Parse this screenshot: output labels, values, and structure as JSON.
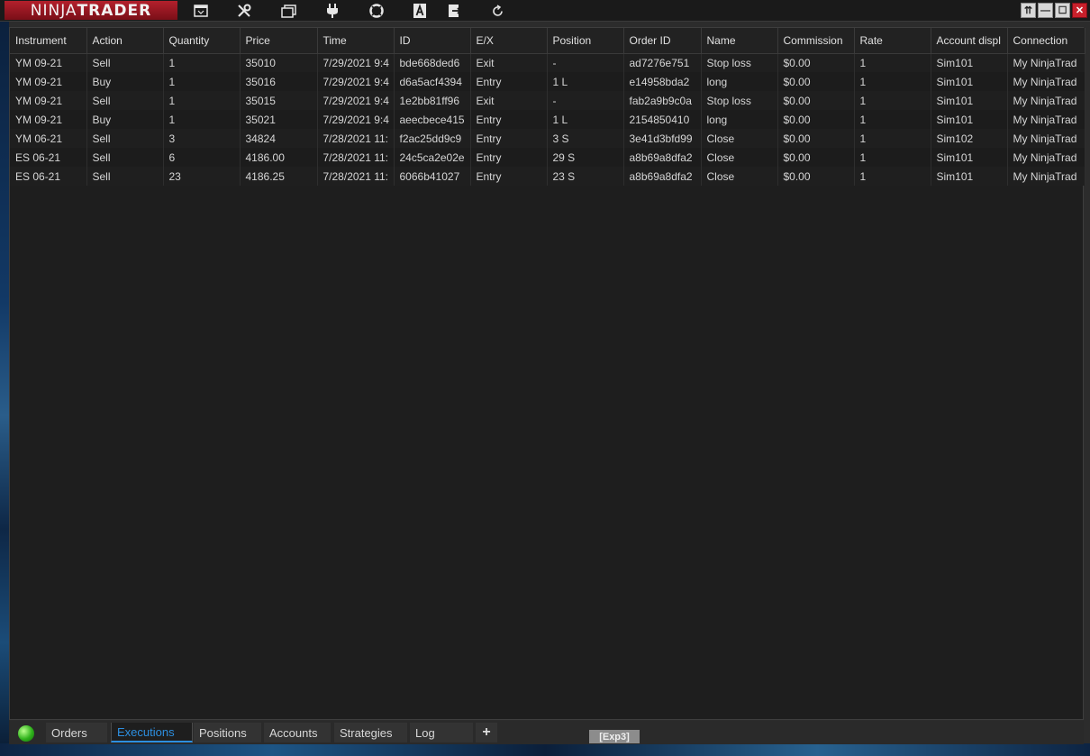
{
  "app": {
    "logo_left": "NINJA",
    "logo_right": "TRADER"
  },
  "toolbar": {
    "icons": [
      "new-window-icon",
      "tools-icon",
      "workspaces-icon",
      "connections-icon",
      "help-icon",
      "font-icon",
      "export-icon",
      "refresh-icon"
    ]
  },
  "window_controls": {
    "pin": "⇈",
    "minimize": "—",
    "maximize": "☐",
    "close": "✕"
  },
  "grid": {
    "columns": [
      "Instrument",
      "Action",
      "Quantity",
      "Price",
      "Time",
      "ID",
      "E/X",
      "Position",
      "Order ID",
      "Name",
      "Commission",
      "Rate",
      "Account displ",
      "Connection"
    ],
    "rows": [
      [
        "YM 09-21",
        "Sell",
        "1",
        "35010",
        "7/29/2021 9:4",
        "bde668ded6",
        "Exit",
        "-",
        "ad7276e751",
        "Stop loss",
        "$0.00",
        "1",
        "Sim101",
        "My NinjaTrad"
      ],
      [
        "YM 09-21",
        "Buy",
        "1",
        "35016",
        "7/29/2021 9:4",
        "d6a5acf4394",
        "Entry",
        "1 L",
        "e14958bda2",
        "long",
        "$0.00",
        "1",
        "Sim101",
        "My NinjaTrad"
      ],
      [
        "YM 09-21",
        "Sell",
        "1",
        "35015",
        "7/29/2021 9:4",
        "1e2bb81ff96",
        "Exit",
        "-",
        "fab2a9b9c0a",
        "Stop loss",
        "$0.00",
        "1",
        "Sim101",
        "My NinjaTrad"
      ],
      [
        "YM 09-21",
        "Buy",
        "1",
        "35021",
        "7/29/2021 9:4",
        "aeecbece415",
        "Entry",
        "1 L",
        "2154850410",
        "long",
        "$0.00",
        "1",
        "Sim101",
        "My NinjaTrad"
      ],
      [
        "YM 06-21",
        "Sell",
        "3",
        "34824",
        "7/28/2021 11:",
        "f2ac25dd9c9",
        "Entry",
        "3 S",
        "3e41d3bfd99",
        "Close",
        "$0.00",
        "1",
        "Sim102",
        "My NinjaTrad"
      ],
      [
        "ES 06-21",
        "Sell",
        "6",
        "4186.00",
        "7/28/2021 11:",
        "24c5ca2e02e",
        "Entry",
        "29 S",
        "a8b69a8dfa2",
        "Close",
        "$0.00",
        "1",
        "Sim101",
        "My NinjaTrad"
      ],
      [
        "ES 06-21",
        "Sell",
        "23",
        "4186.25",
        "7/28/2021 11:",
        "6066b41027",
        "Entry",
        "23 S",
        "a8b69a8dfa2",
        "Close",
        "$0.00",
        "1",
        "Sim101",
        "My NinjaTrad"
      ]
    ]
  },
  "tabs": [
    {
      "label": "Orders",
      "active": false
    },
    {
      "label": "Executions",
      "active": true
    },
    {
      "label": "Positions",
      "active": false
    },
    {
      "label": "Accounts",
      "active": false
    },
    {
      "label": "Strategies",
      "active": false
    },
    {
      "label": "Log",
      "active": false
    }
  ],
  "add_tab_label": "+",
  "status": {
    "connection_color": "#2fb21b",
    "exp_label": "[Exp3]"
  }
}
